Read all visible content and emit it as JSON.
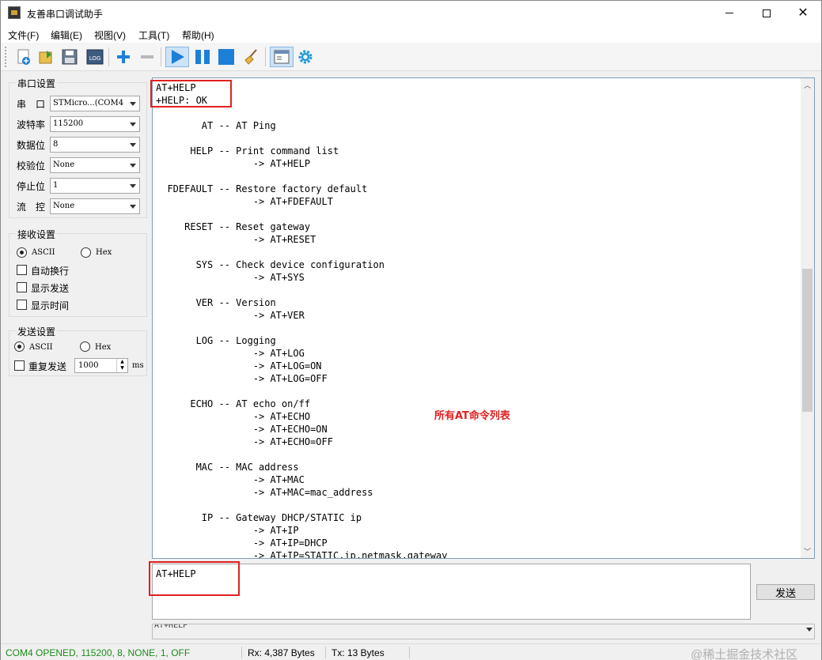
{
  "window": {
    "title": "友善串口调试助手"
  },
  "menu": {
    "file": "文件(F)",
    "edit": "编辑(E)",
    "view": "视图(V)",
    "tools": "工具(T)",
    "help": "帮助(H)"
  },
  "toolbar": {
    "icons": [
      "new-icon",
      "open-icon",
      "save-icon",
      "log-icon",
      "add-icon",
      "remove-icon",
      "play-icon",
      "pause-icon",
      "stop-icon",
      "broom-icon",
      "window-icon",
      "settings-icon"
    ],
    "log_label": "LOG"
  },
  "serial_settings": {
    "title": "串口设置",
    "port_label": "串　口",
    "port_value": "STMicro...(COM4",
    "baud_label": "波特率",
    "baud_value": "115200",
    "databits_label": "数据位",
    "databits_value": "8",
    "parity_label": "校验位",
    "parity_value": "None",
    "stopbits_label": "停止位",
    "stopbits_value": "1",
    "flow_label": "流　控",
    "flow_value": "None"
  },
  "receive_settings": {
    "title": "接收设置",
    "ascii_label": "ASCII",
    "hex_label": "Hex",
    "auto_wrap_label": "自动换行",
    "show_send_label": "显示发送",
    "show_time_label": "显示时间"
  },
  "send_settings": {
    "title": "发送设置",
    "ascii_label": "ASCII",
    "hex_label": "Hex",
    "repeat_label": "重复发送",
    "interval_value": "1000",
    "interval_unit": "ms"
  },
  "receive": {
    "text": "AT+HELP\n+HELP: OK\n\n        AT -- AT Ping\n\n      HELP -- Print command list\n                 -> AT+HELP\n\n  FDEFAULT -- Restore factory default\n                 -> AT+FDEFAULT\n\n     RESET -- Reset gateway\n                 -> AT+RESET\n\n       SYS -- Check device configuration\n                 -> AT+SYS\n\n       VER -- Version\n                 -> AT+VER\n\n       LOG -- Logging\n                 -> AT+LOG\n                 -> AT+LOG=ON\n                 -> AT+LOG=OFF\n\n      ECHO -- AT echo on/ff\n                 -> AT+ECHO\n                 -> AT+ECHO=ON\n                 -> AT+ECHO=OFF\n\n       MAC -- MAC address\n                 -> AT+MAC\n                 -> AT+MAC=mac_address\n\n        IP -- Gateway DHCP/STATIC ip\n                 -> AT+IP\n                 -> AT+IP=DHCP\n                 -> AT+IP=STATIC,ip,netmask,gateway",
    "annotation": "所有AT命令列表"
  },
  "send": {
    "text": "AT+HELP",
    "button_label": "发送",
    "history_value": "AT+HELP"
  },
  "status": {
    "connection": "COM4 OPENED, 115200, 8, NONE, 1, OFF",
    "rx": "Rx: 4,387 Bytes",
    "tx": "Tx: 13 Bytes",
    "watermark": "@稀土掘金技术社区",
    "connection_color": "#1a8c1a"
  },
  "colors": {
    "annotation_red": "#e02020",
    "toolbar_blue": "#1e7fd8"
  }
}
